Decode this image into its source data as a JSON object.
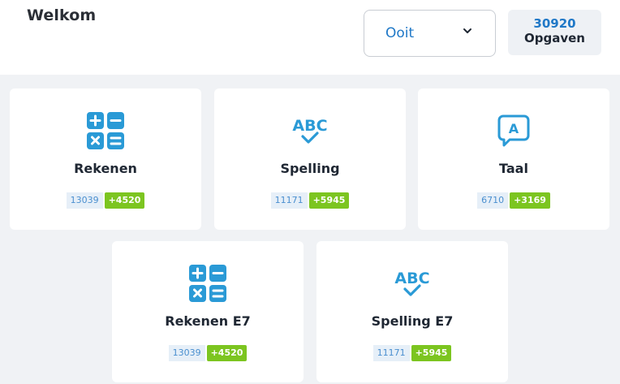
{
  "header": {
    "welcome": "Welkom",
    "period": {
      "selected": "Ooit"
    },
    "total": {
      "count": "30920",
      "label": "Opgaven"
    }
  },
  "colors": {
    "accent": "#1f78c7",
    "icon": "#2a9ad6",
    "delta": "#7cc520",
    "count_bg": "#e6eff8"
  },
  "cards": [
    {
      "title": "Rekenen",
      "icon": "calculator-icon",
      "count": "13039",
      "delta": "+4520"
    },
    {
      "title": "Spelling",
      "icon": "abc-check-icon",
      "count": "11171",
      "delta": "+5945"
    },
    {
      "title": "Taal",
      "icon": "speech-bubble-a-icon",
      "count": "6710",
      "delta": "+3169"
    },
    {
      "title": "Rekenen E7",
      "icon": "calculator-icon",
      "count": "13039",
      "delta": "+4520"
    },
    {
      "title": "Spelling E7",
      "icon": "abc-check-icon",
      "count": "11171",
      "delta": "+5945"
    }
  ]
}
